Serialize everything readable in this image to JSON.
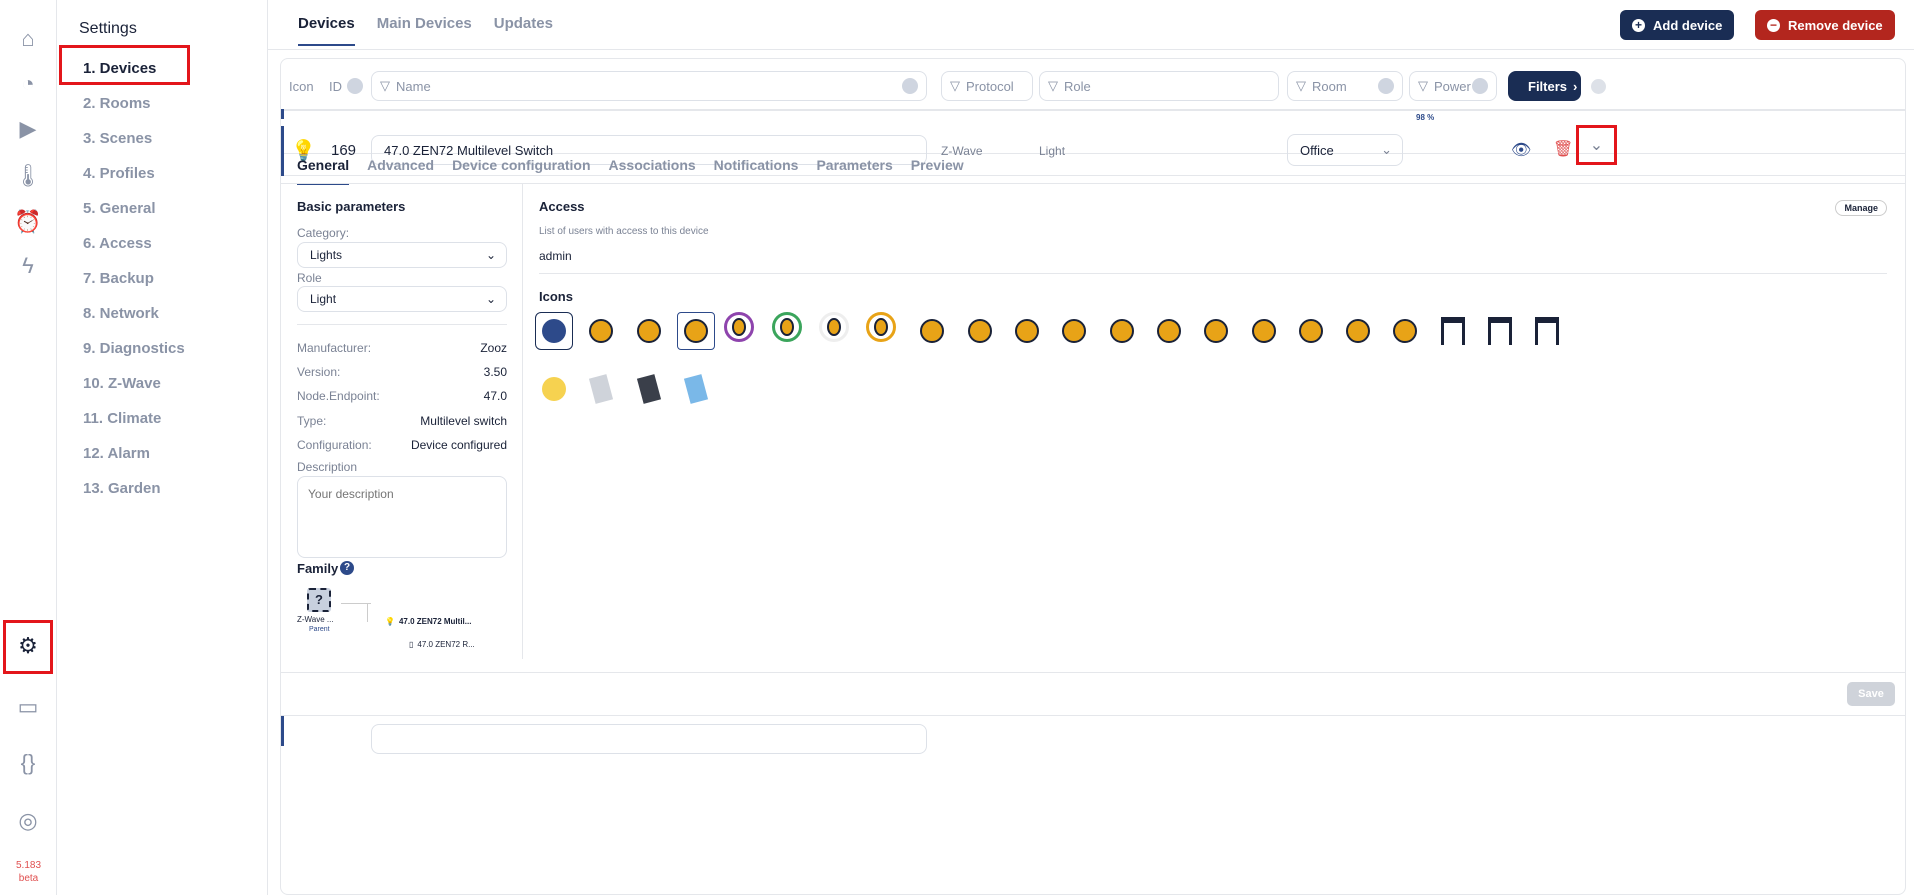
{
  "rail": {
    "items": [
      "home-icon",
      "history-icon",
      "play-icon",
      "thermometer-icon",
      "alarm-icon",
      "bolt-icon",
      "gear-icon",
      "terminal-icon",
      "api-icon",
      "support-icon"
    ],
    "version": "5.183",
    "channel": "beta"
  },
  "settings": {
    "title": "Settings",
    "items": [
      "1.  Devices",
      "2.  Rooms",
      "3.  Scenes",
      "4.  Profiles",
      "5.  General",
      "6.  Access",
      "7.  Backup",
      "8.  Network",
      "9.  Diagnostics",
      "10.  Z-Wave",
      "11.  Climate",
      "12.  Alarm",
      "13.  Garden"
    ]
  },
  "header": {
    "tabs": [
      "Devices",
      "Main Devices",
      "Updates"
    ],
    "add": "Add device",
    "remove": "Remove device"
  },
  "filters": {
    "icon": "Icon",
    "id": "ID",
    "name": "Name",
    "protocol": "Protocol",
    "role": "Role",
    "room": "Room",
    "power": "Power",
    "button": "Filters"
  },
  "prev_row": {
    "power": "98 %"
  },
  "device": {
    "id": "169",
    "name": "47.0 ZEN72 Multilevel Switch",
    "protocol": "Z-Wave",
    "role": "Light",
    "room": "Office"
  },
  "detail": {
    "tabs": [
      "General",
      "Advanced",
      "Device configuration",
      "Associations",
      "Notifications",
      "Parameters",
      "Preview"
    ],
    "basic": "Basic parameters",
    "category_label": "Category:",
    "category": "Lights",
    "role_label": "Role",
    "role": "Light",
    "info": [
      [
        "Manufacturer:",
        "Zooz"
      ],
      [
        "Version:",
        "3.50"
      ],
      [
        "Node.Endpoint:",
        "47.0"
      ],
      [
        "Type:",
        "Multilevel switch"
      ],
      [
        "Configuration:",
        "Device configured"
      ]
    ],
    "description_label": "Description",
    "description_placeholder": "Your description",
    "family": "Family",
    "parent_name": "Z-Wave ...",
    "parent_label": "Parent",
    "child1": "47.0 ZEN72 Multil...",
    "child2": "47.0 ZEN72 R...",
    "access": "Access",
    "manage": "Manage",
    "access_sub": "List of users with access to this device",
    "user": "admin",
    "icons": "Icons",
    "save": "Save"
  },
  "colors": {
    "navy": "#1a2d54",
    "red": "#b3261e",
    "accent": "#2d4a8a",
    "orange": "#e8a317"
  }
}
